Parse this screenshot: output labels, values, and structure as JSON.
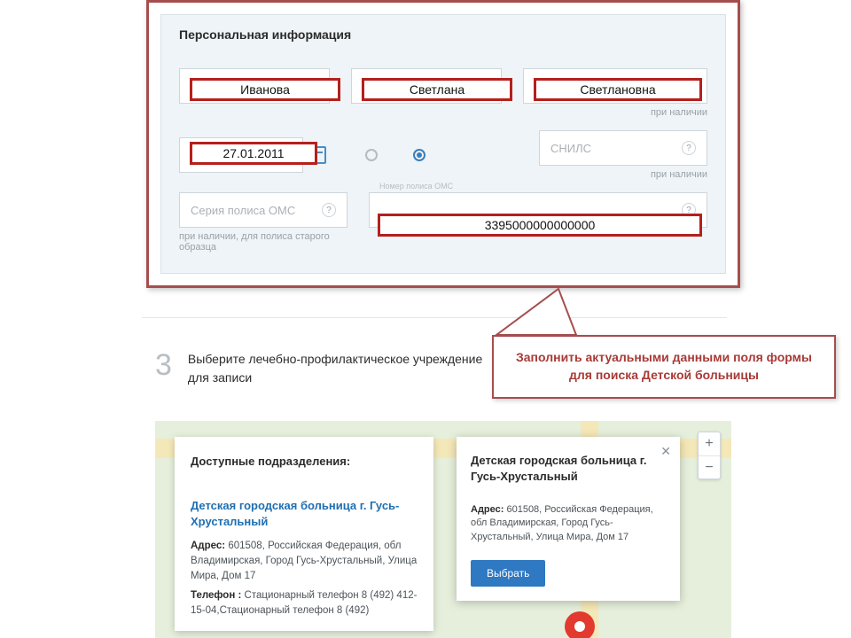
{
  "panel": {
    "title": "Персональная информация",
    "surname": "Иванова",
    "name": "Светлана",
    "patronymic": "Светлановна",
    "patronymic_hint": "при наличии",
    "dob": "27.01.2011",
    "snils_placeholder": "СНИЛС",
    "snils_hint": "при наличии",
    "oms_series_placeholder": "Серия полиса ОМС",
    "oms_series_hint": "при наличии, для полиса старого образца",
    "oms_number_label": "Номер полиса ОМС",
    "oms_number": "3395000000000000"
  },
  "step3": {
    "num": "3",
    "text": "Выберите лечебно-профилактическое учреждение для записи"
  },
  "callout": {
    "text": "Заполнить актуальными данными поля формы для поиска Детской больницы"
  },
  "facility": {
    "list_title": "Доступные подразделения:",
    "name": "Детская городская больница г. Гусь-Хрустальный",
    "address_label": "Адрес:",
    "address": "601508, Российская Федерация, обл Владимирская, Город Гусь-Хрустальный, Улица Мира, Дом 17",
    "phone_label": "Телефон :",
    "phone": "Стационарный телефон 8 (492) 412-15-04,Стационарный телефон 8 (492)"
  },
  "popup": {
    "title": "Детская городская больница г. Гусь-Хрустальный",
    "address_label": "Адрес:",
    "address": "601508, Российская Федерация, обл Владимирская, Город Гусь-Хрустальный, Улица Мира, Дом 17",
    "select_label": "Выбрать"
  },
  "zoom": {
    "plus": "+",
    "minus": "−"
  }
}
